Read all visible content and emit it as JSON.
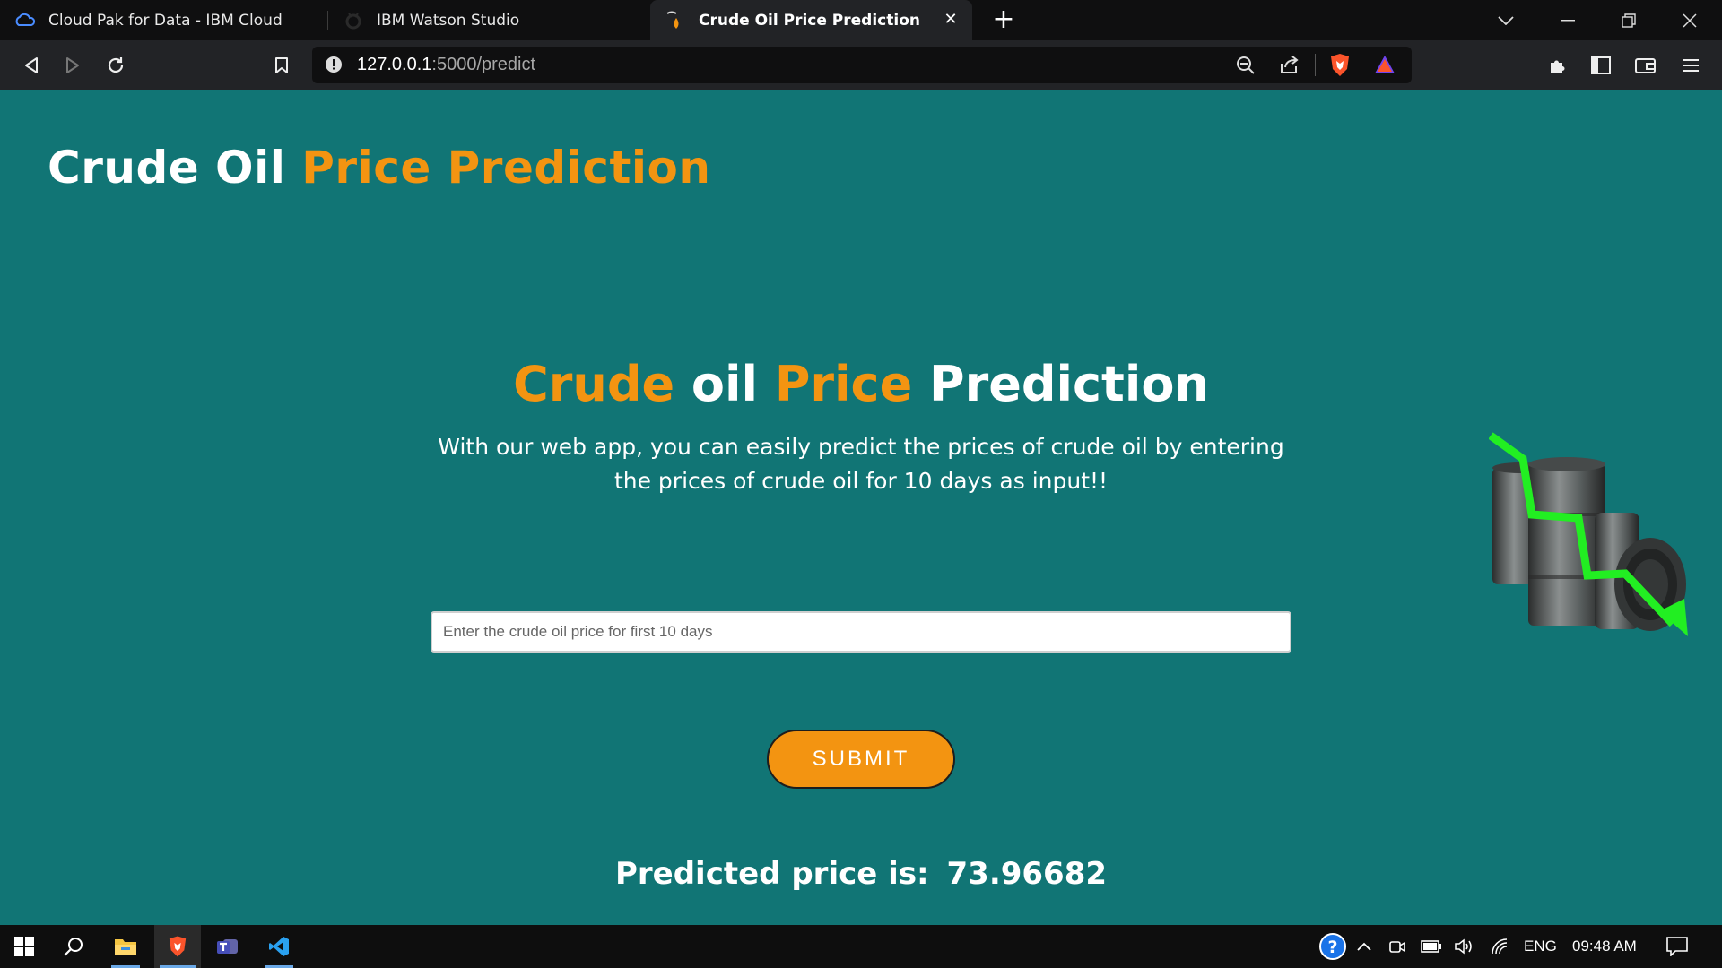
{
  "browser": {
    "tabs": [
      {
        "title": "Cloud Pak for Data - IBM Cloud",
        "icon": "ibm-cloud-icon",
        "active": false
      },
      {
        "title": "IBM Watson Studio",
        "icon": "watson-icon",
        "active": false
      },
      {
        "title": "Crude Oil Price Prediction",
        "icon": "oil-drop-icon",
        "active": true
      }
    ],
    "url": {
      "host": "127.0.0.1",
      "path": ":5000/predict"
    }
  },
  "page": {
    "brand": {
      "part1": "Crude Oil",
      "part2": "Price Prediction"
    },
    "hero": {
      "w1": "Crude",
      "w2": "oil",
      "w3": "Price",
      "w4": "Prediction",
      "subtitle": "With our web app, you can easily predict the prices of crude oil by entering the prices of crude oil for 10 days as input!!"
    },
    "form": {
      "input_placeholder": "Enter the crude oil price for first 10 days",
      "input_value": "",
      "submit_label": "SUBMIT"
    },
    "result": {
      "label": "Predicted price is:",
      "value": "73.96682"
    },
    "colors": {
      "background": "#117575",
      "accent": "#f39411",
      "arrow": "#22ee22"
    }
  },
  "taskbar": {
    "language": "ENG",
    "time": "09:48 AM"
  }
}
